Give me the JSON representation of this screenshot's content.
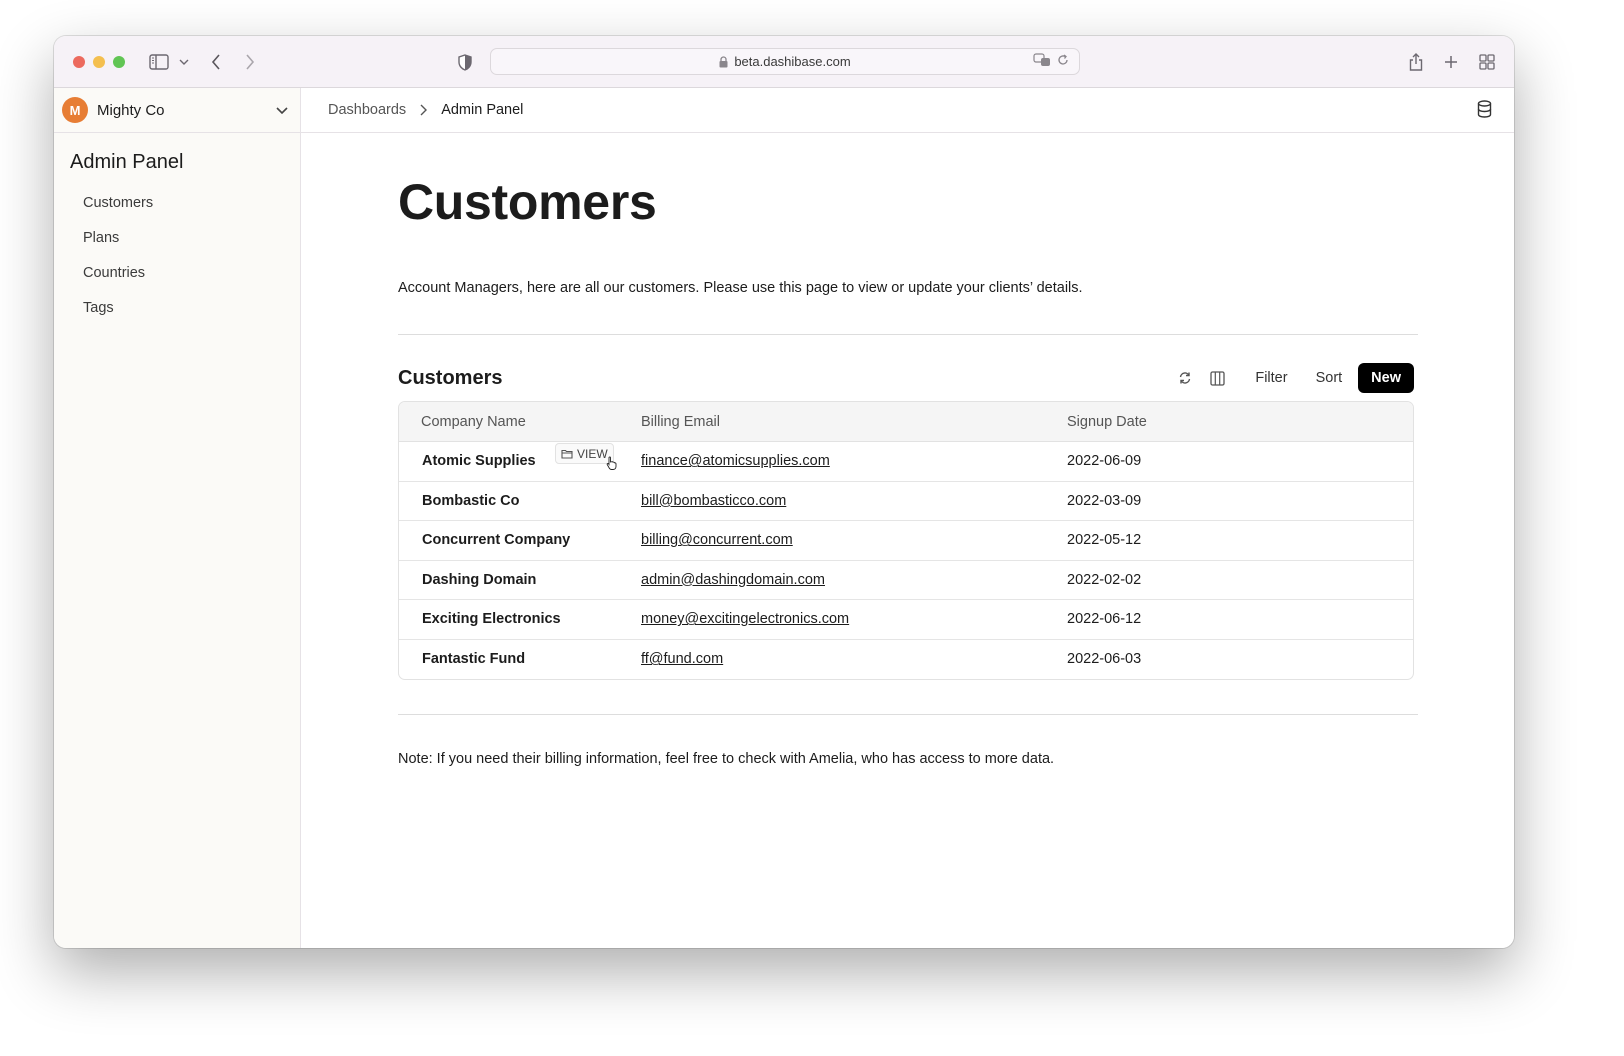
{
  "browser": {
    "url": "beta.dashibase.com"
  },
  "sidebar": {
    "workspace": {
      "avatar_letter": "M",
      "name": "Mighty Co",
      "avatar_color": "#e77d34"
    },
    "title": "Admin Panel",
    "items": [
      {
        "label": "Customers"
      },
      {
        "label": "Plans"
      },
      {
        "label": "Countries"
      },
      {
        "label": "Tags"
      }
    ]
  },
  "breadcrumb": {
    "parent": "Dashboards",
    "current": "Admin Panel"
  },
  "page": {
    "title": "Customers",
    "intro": "Account Managers, here are all our customers. Please use this page to view or update your clients’ details.",
    "note": "Note: If you need their billing information, feel free to check with Amelia, who has access to more data."
  },
  "table": {
    "title": "Customers",
    "toolbar": {
      "filter_label": "Filter",
      "sort_label": "Sort",
      "new_label": "New"
    },
    "view_label": "VIEW",
    "columns": [
      "Company Name",
      "Billing Email",
      "Signup Date"
    ],
    "rows": [
      {
        "company": "Atomic Supplies",
        "email": "finance@atomicsupplies.com",
        "date": "2022-06-09"
      },
      {
        "company": "Bombastic Co",
        "email": "bill@bombasticco.com",
        "date": "2022-03-09"
      },
      {
        "company": "Concurrent Company",
        "email": "billing@concurrent.com",
        "date": "2022-05-12"
      },
      {
        "company": "Dashing Domain",
        "email": "admin@dashingdomain.com",
        "date": "2022-02-02"
      },
      {
        "company": "Exciting Electronics",
        "email": "money@excitingelectronics.com",
        "date": "2022-06-12"
      },
      {
        "company": "Fantastic Fund",
        "email": "ff@fund.com",
        "date": "2022-06-03"
      }
    ]
  }
}
